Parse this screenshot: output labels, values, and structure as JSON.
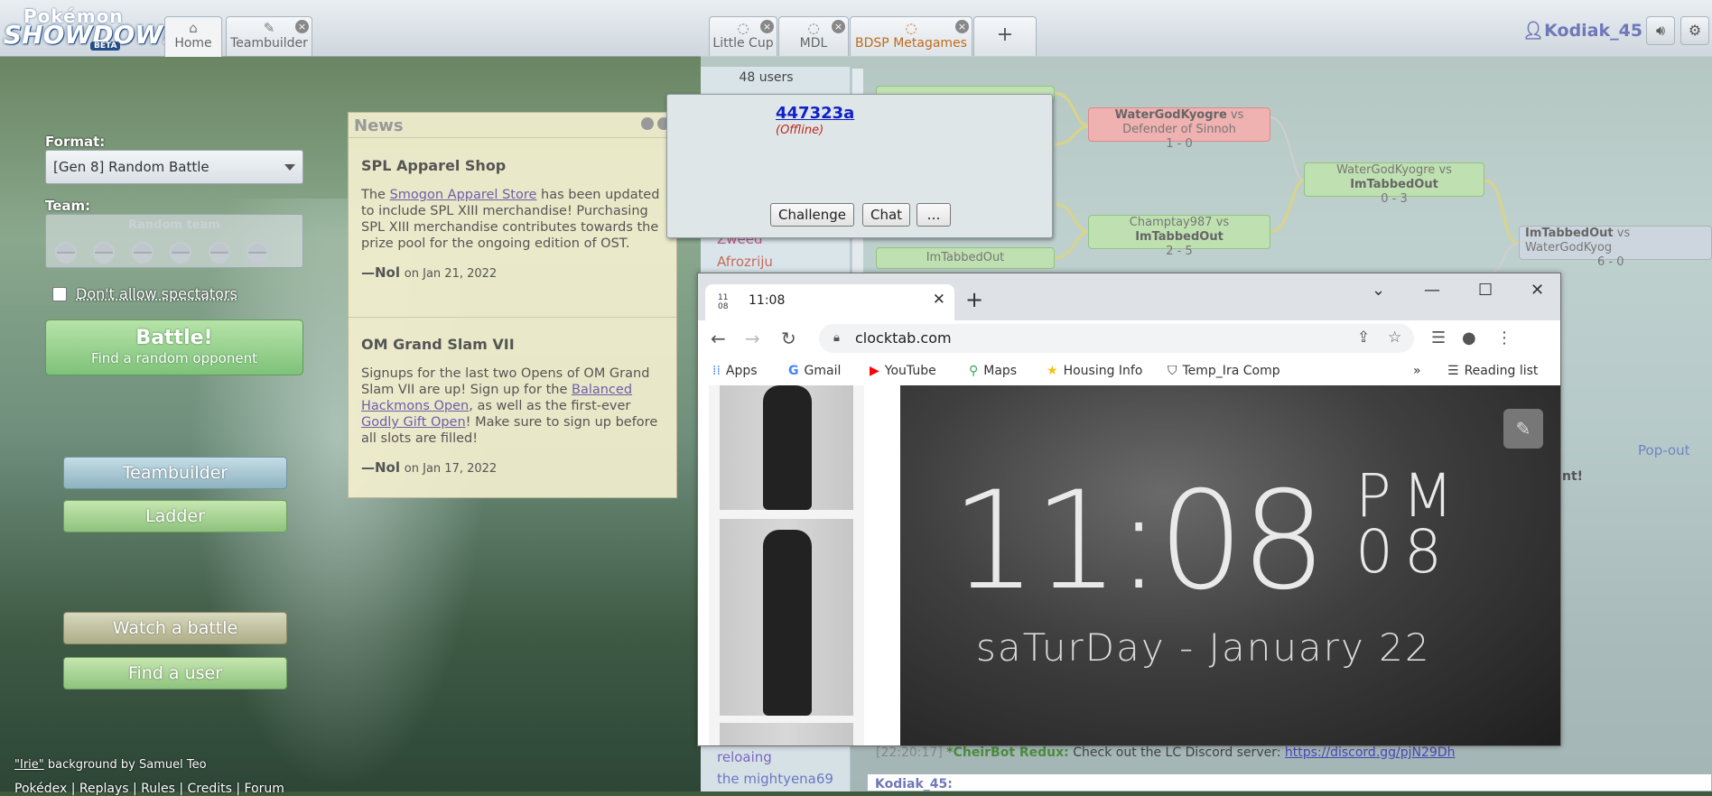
{
  "app": {
    "logo_top": "Pokémon",
    "logo_main": "SHOWDOWN",
    "logo_badge": "BETA"
  },
  "tabs": [
    {
      "label": "Home"
    },
    {
      "label": "Teambuilder"
    },
    {
      "label": "Little Cup"
    },
    {
      "label": "MDL"
    },
    {
      "label": "BDSP Metagames"
    }
  ],
  "user": {
    "name": "Kodiak_45"
  },
  "home": {
    "format_label": "Format:",
    "format_value": "[Gen 8] Random Battle",
    "team_label": "Team:",
    "team_value": "Random team",
    "spectators_label": "Don't allow spectators",
    "battle_label": "Battle!",
    "battle_sub": "Find a random opponent",
    "teambuilder": "Teambuilder",
    "ladder": "Ladder",
    "watch": "Watch a battle",
    "find_user": "Find a user",
    "credit_name": "\"Irie\"",
    "credit_rest": " background by Samuel Teo",
    "footer_links": "Pokédex | Replays | Rules | Credits | Forum"
  },
  "news": {
    "title": "News",
    "items": [
      {
        "headline": "SPL Apparel Shop",
        "p1": "The ",
        "link1": "Smogon Apparel Store",
        "p2": " has been updated to include SPL XIII merchandise! Purchasing SPL XIII merchandise contributes towards the prize pool for the ongoing edition of OST.",
        "author": "—Nol",
        "date": "on Jan 21, 2022"
      },
      {
        "headline": "OM Grand Slam VII",
        "p1": "Signups for the last two Opens of OM Grand Slam VII are up! Sign up for the ",
        "link1": "Balanced Hackmons Open",
        "p2": ", as well as the first-ever ",
        "link2": "Godly Gift Open",
        "p3": "! Make sure to sign up before all slots are filled!",
        "author": "—Nol",
        "date": "on Jan 17, 2022"
      }
    ]
  },
  "room": {
    "user_count": "48 users",
    "users": [
      "Zweed",
      "Afrozriju",
      "reloaing",
      "the mightyena69"
    ],
    "bracket": [
      {
        "p1": "WaterGodKyogre",
        "vs": "vs",
        "p2": "Defender of Sinnoh",
        "score": "1 - 0"
      },
      {
        "p1": "WaterGodKyogre",
        "vs": "vs",
        "p2": "ImTabbedOut",
        "score": "0 - 3"
      },
      {
        "p1": "Champtay987",
        "vs": "vs",
        "p2": "ImTabbedOut",
        "score": "2 - 5"
      },
      {
        "p1": "ImTabbedOut",
        "vs": "vs",
        "p2": "WaterGodKyog",
        "score": "6 - 0"
      },
      {
        "p1": "ImTabbedOut"
      }
    ],
    "popout": "Pop-out",
    "partial_text": "nt!",
    "chat_time": "[22:20:17]",
    "chat_user": "*CheirBot Redux:",
    "chat_msg": "Check out the LC Discord server:",
    "chat_link": "https://discord.gg/pjN29Dh",
    "input_user": "Kodiak_45:"
  },
  "popup": {
    "name": "447323a",
    "status": "(Offline)",
    "challenge": "Challenge",
    "chat": "Chat",
    "more": "…"
  },
  "browser": {
    "tab_favicon_top": "11",
    "tab_favicon_bottom": "08",
    "tab_title": "11:08",
    "url": "clocktab.com",
    "bookmarks": [
      "Apps",
      "Gmail",
      "YouTube",
      "Maps",
      "Housing Info",
      "Temp_Ira Comp"
    ],
    "more_bookmarks": "»",
    "reading_list": "Reading list"
  },
  "clock": {
    "time": "11:08",
    "ampm": "PM",
    "seconds": "08",
    "date": "saTurDay - January 22"
  }
}
